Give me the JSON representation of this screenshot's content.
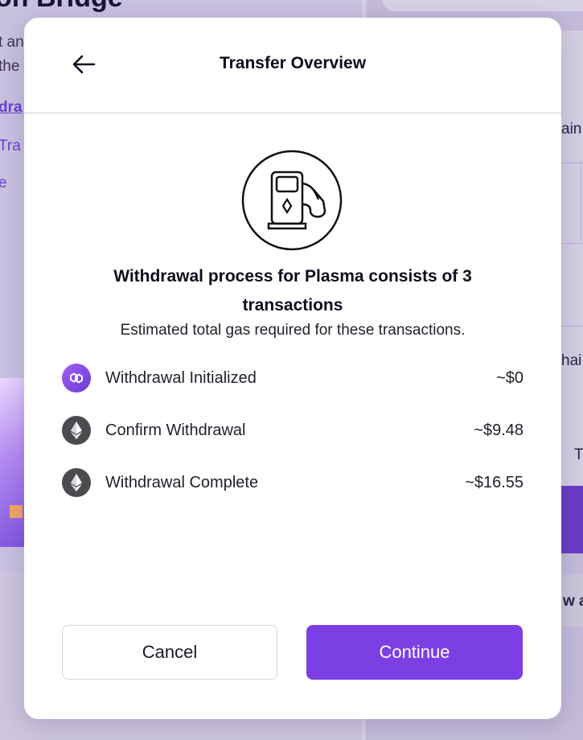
{
  "background": {
    "title_fragment": "on Bridge",
    "line1": "t an",
    "line2": "the",
    "link1": "dra",
    "link2": "Tra",
    "link3": "e",
    "right_text1": "ain",
    "right_text2": "hai",
    "right_text3": "T",
    "right_text4": "w a"
  },
  "modal": {
    "title": "Transfer Overview",
    "back_icon": "arrow-left-icon",
    "illustration_icon": "gas-pump-icon",
    "headline": "Withdrawal process for Plasma consists of 3 transactions",
    "subline": "Estimated total gas required for these transactions.",
    "transactions": [
      {
        "label": "Withdrawal Initialized",
        "cost": "~$0",
        "icon": "polygon-icon",
        "icon_color": "#8247e5"
      },
      {
        "label": "Confirm Withdrawal",
        "cost": "~$9.48",
        "icon": "ethereum-icon",
        "icon_color": "#4a4a4f"
      },
      {
        "label": "Withdrawal Complete",
        "cost": "~$16.55",
        "icon": "ethereum-icon",
        "icon_color": "#4a4a4f"
      }
    ],
    "cancel_label": "Cancel",
    "continue_label": "Continue"
  },
  "colors": {
    "accent": "#7b3fe4",
    "overlay": "#c9c1e0"
  }
}
